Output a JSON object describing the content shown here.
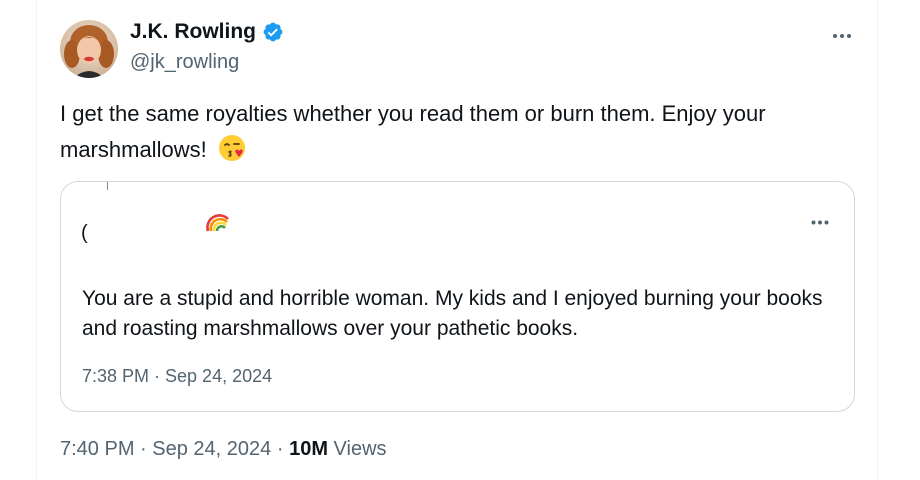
{
  "author": {
    "name": "J.K. Rowling",
    "handle": "@jk_rowling",
    "verified": true,
    "verified_color": "#1d9bf0",
    "avatar_icon": "profile-photo"
  },
  "tweet": {
    "text": "I get the same royalties whether you read them or burn them. Enjoy your marshmallows!",
    "emoji_icon": "face-blowing-kiss-emoji",
    "time": "7:40 PM",
    "date": "Sep 24, 2024",
    "separator": "·",
    "views_count": "10M",
    "views_label": "Views"
  },
  "quoted_tweet": {
    "author_fragment": "(",
    "author_emoji_icon": "rainbow-emoji",
    "text": "You are a stupid and horrible woman. My kids and I enjoyed burning your books and roasting marshmallows over your pathetic books.",
    "timestamp": "7:38 PM · Sep 24, 2024"
  },
  "colors": {
    "text_primary": "#0f1419",
    "text_secondary": "#536471",
    "border": "#cfd9de"
  }
}
